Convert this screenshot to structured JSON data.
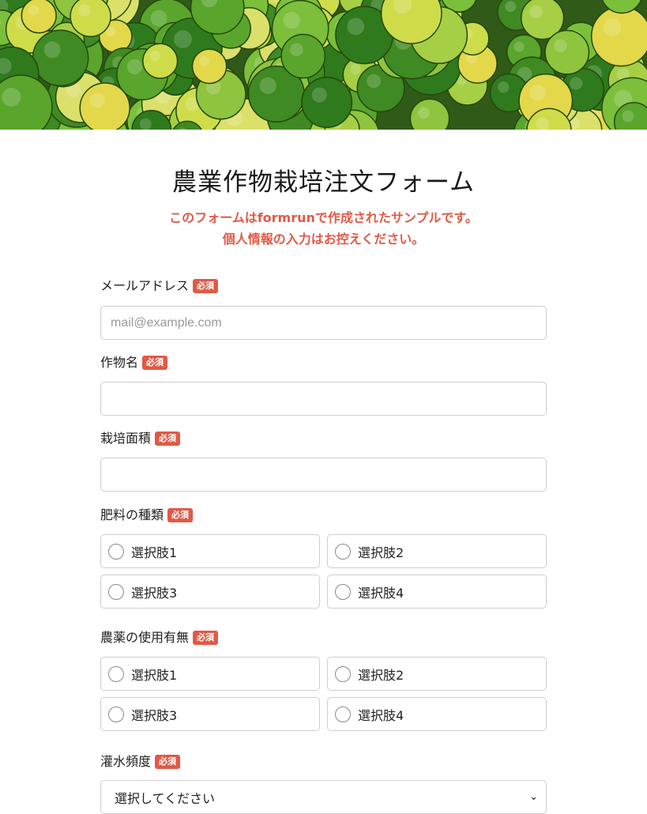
{
  "form": {
    "title": "農業作物栽培注文フォーム",
    "notice_line1": "このフォームはformrunで作成されたサンプルです。",
    "notice_line2": "個人情報の入力はお控えください。",
    "required_badge": "必須"
  },
  "fields": {
    "email": {
      "label": "メールアドレス",
      "placeholder": "mail@example.com",
      "value": ""
    },
    "crop_name": {
      "label": "作物名",
      "value": ""
    },
    "cultivation_area": {
      "label": "栽培面積",
      "value": ""
    },
    "fertilizer_type": {
      "label": "肥料の種類",
      "options": [
        "選択肢1",
        "選択肢2",
        "選択肢3",
        "選択肢4"
      ]
    },
    "pesticide_use": {
      "label": "農薬の使用有無",
      "options": [
        "選択肢1",
        "選択肢2",
        "選択肢3",
        "選択肢4"
      ]
    },
    "irrigation_frequency": {
      "label": "灌水頻度",
      "selected": "選択してください"
    }
  },
  "colors": {
    "accent": "#e05a47",
    "border": "#cfcfcf",
    "text": "#222222"
  },
  "icons": {
    "select_chevron": "chevron-down-icon",
    "radio": "radio-circle-icon"
  }
}
